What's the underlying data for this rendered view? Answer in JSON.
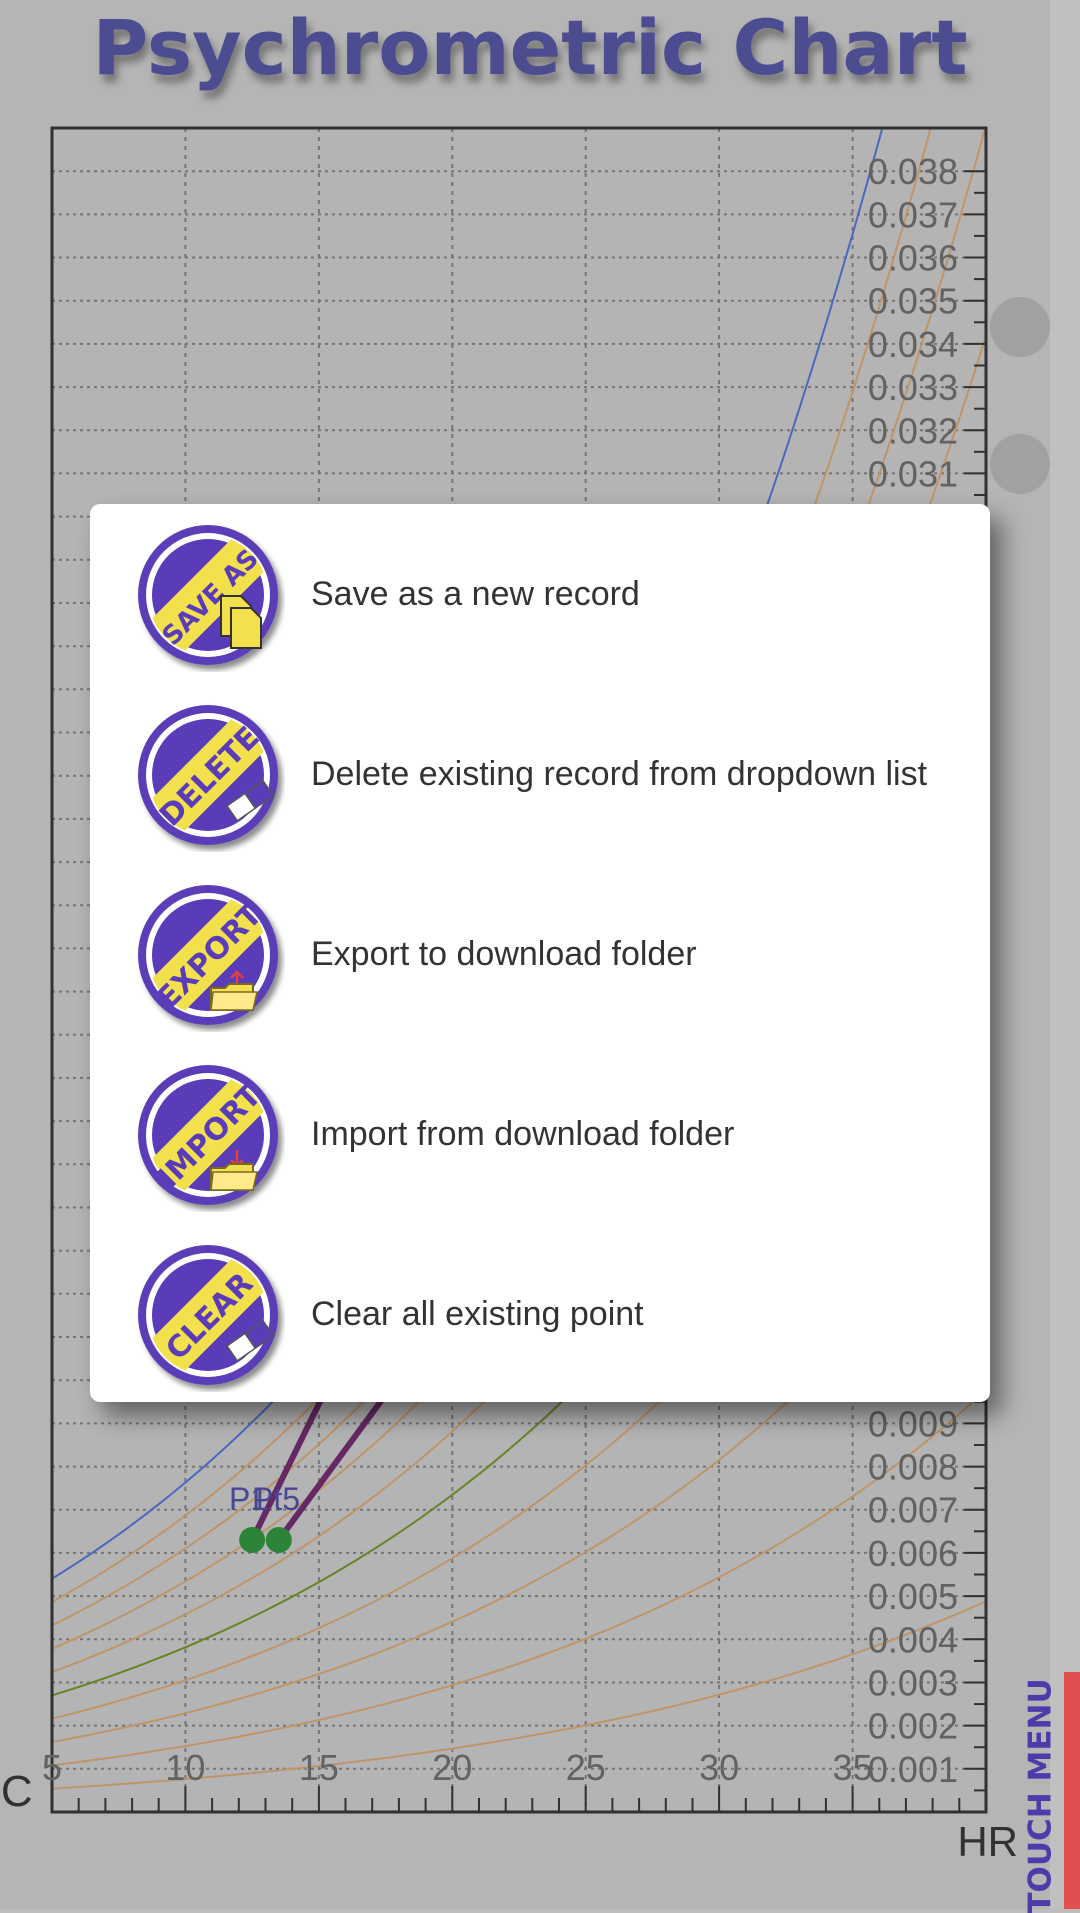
{
  "app": {
    "title": "Psychrometric Chart"
  },
  "chart_data": {
    "type": "line",
    "x_ticks": [
      "5",
      "10",
      "15",
      "20",
      "25",
      "30",
      "35"
    ],
    "x_unit": "°C",
    "y_ticks": [
      "0.001",
      "0.002",
      "0.003",
      "0.004",
      "0.005",
      "0.006",
      "0.007",
      "0.008",
      "0.009",
      "0.031",
      "0.032",
      "0.033",
      "0.034",
      "0.035",
      "0.036",
      "0.037",
      "0.038"
    ],
    "y_label": "HR",
    "xlim": [
      5,
      40
    ],
    "ylim": [
      0,
      0.039
    ],
    "grid": true,
    "point_labels": [
      "P1",
      "Pt5"
    ],
    "colors": {
      "saturation_line": "#4a6ec8",
      "rh_curves": "#c89b6e",
      "reference_curve": "#6b8a2a",
      "process_line": "#6a2a6a",
      "points": "#2d8a3a"
    }
  },
  "menu": {
    "items": [
      {
        "id": "save-as",
        "badge": "SAVE AS",
        "label": "Save as a new record",
        "icon": "document-icon"
      },
      {
        "id": "delete",
        "badge": "DELETE",
        "label": "Delete existing record from dropdown list",
        "icon": "eraser-icon"
      },
      {
        "id": "export",
        "badge": "EXPORT",
        "label": "Export to download folder",
        "icon": "folder-upload-icon"
      },
      {
        "id": "import",
        "badge": "IMPORT",
        "label": "Import from download folder",
        "icon": "folder-download-icon"
      },
      {
        "id": "clear",
        "badge": "CLEAR",
        "label": "Clear all existing point",
        "icon": "eraser-icon"
      }
    ]
  },
  "side": {
    "touch_menu": "TOUCH MENU"
  },
  "colors": {
    "badge_purple": "#5b3cb8",
    "badge_yellow": "#f2e14c",
    "title": "#505096"
  }
}
